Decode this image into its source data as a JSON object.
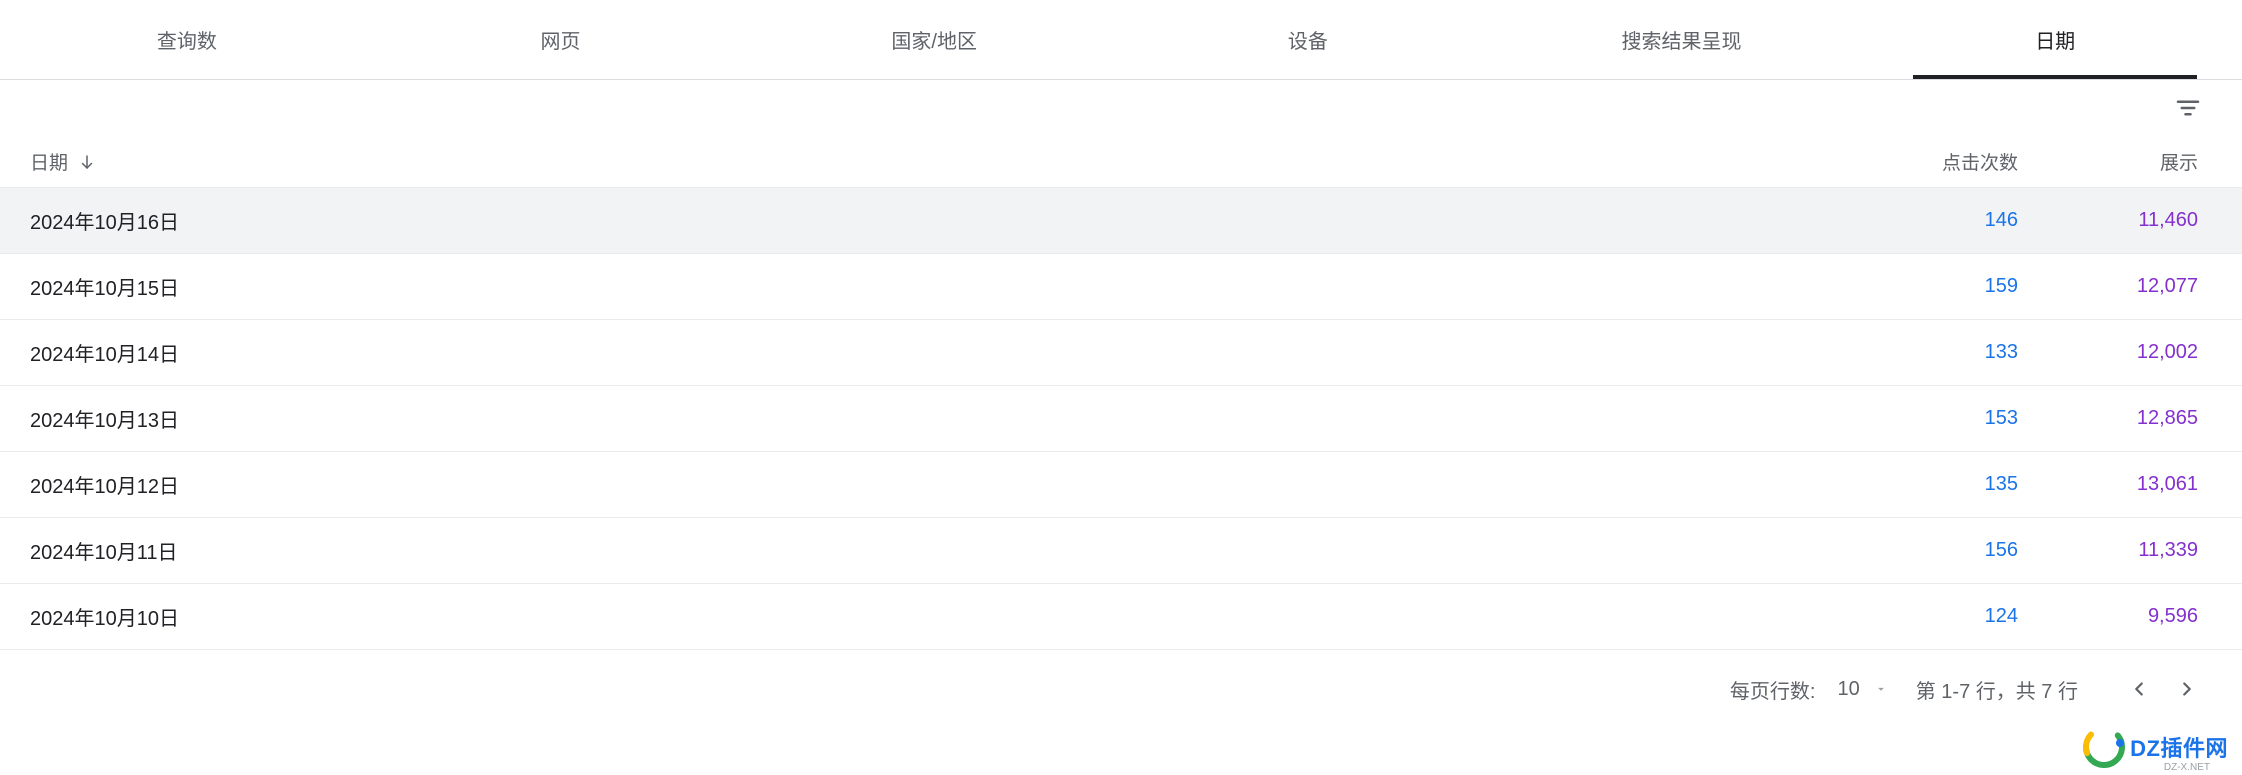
{
  "tabs": [
    {
      "label": "查询数",
      "active": false
    },
    {
      "label": "网页",
      "active": false
    },
    {
      "label": "国家/地区",
      "active": false
    },
    {
      "label": "设备",
      "active": false
    },
    {
      "label": "搜索结果呈现",
      "active": false
    },
    {
      "label": "日期",
      "active": true
    }
  ],
  "columns": {
    "date": "日期",
    "clicks": "点击次数",
    "impressions": "展示"
  },
  "sort": {
    "column": "date",
    "direction": "desc"
  },
  "rows": [
    {
      "date": "2024年10月16日",
      "clicks": "146",
      "impressions": "11,460",
      "hovered": true
    },
    {
      "date": "2024年10月15日",
      "clicks": "159",
      "impressions": "12,077",
      "hovered": false
    },
    {
      "date": "2024年10月14日",
      "clicks": "133",
      "impressions": "12,002",
      "hovered": false
    },
    {
      "date": "2024年10月13日",
      "clicks": "153",
      "impressions": "12,865",
      "hovered": false
    },
    {
      "date": "2024年10月12日",
      "clicks": "135",
      "impressions": "13,061",
      "hovered": false
    },
    {
      "date": "2024年10月11日",
      "clicks": "156",
      "impressions": "11,339",
      "hovered": false
    },
    {
      "date": "2024年10月10日",
      "clicks": "124",
      "impressions": "9,596",
      "hovered": false
    }
  ],
  "pagination": {
    "rows_per_page_label": "每页行数:",
    "rows_per_page_value": "10",
    "range_label": "第 1-7 行，共 7 行"
  },
  "watermark": {
    "main": "DZ插件网",
    "sub": "DZ-X.NET"
  }
}
